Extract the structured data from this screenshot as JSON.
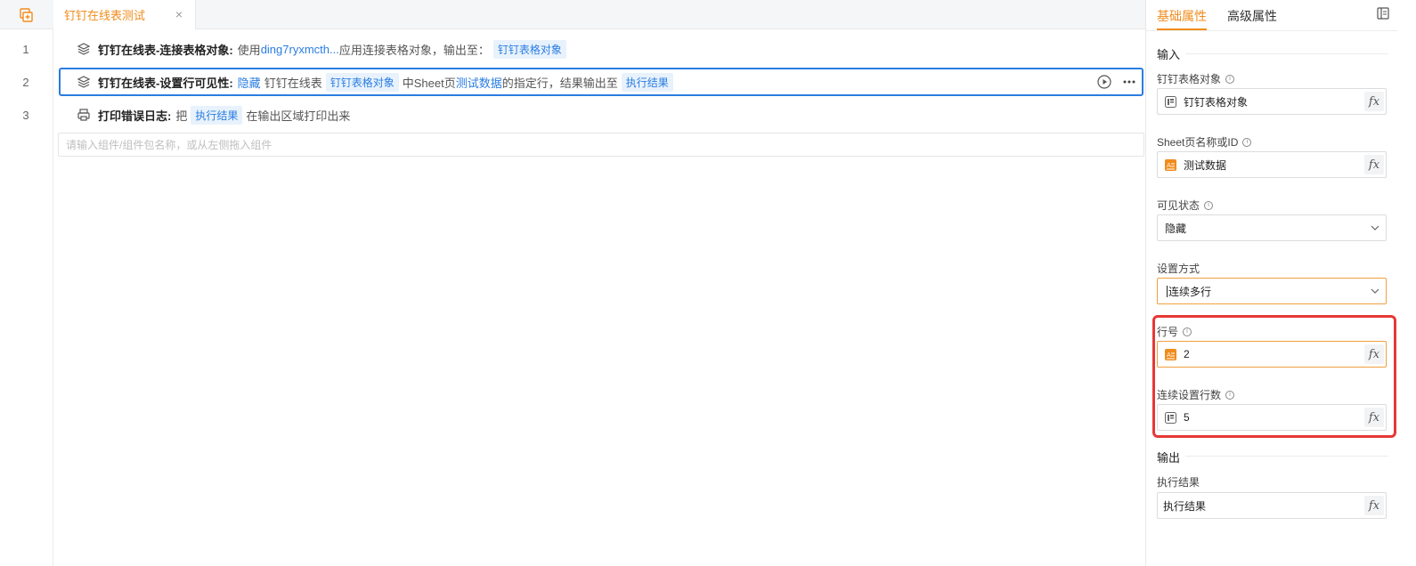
{
  "topbar": {
    "tab_label": "钉钉在线表测试",
    "close_glyph": "×"
  },
  "lines": [
    "1",
    "2",
    "3"
  ],
  "steps": [
    {
      "title": "钉钉在线表-连接表格对象:",
      "pre": "使用",
      "link": "ding7ryxmcth...",
      "mid": "应用连接表格对象，输出至：",
      "chip": "钉钉表格对象"
    },
    {
      "title": "钉钉在线表-设置行可见性:",
      "link1": "隐藏",
      "txt1": "钉钉在线表",
      "chip1": "钉钉表格对象",
      "txt2": "中Sheet页",
      "link2": "测试数据",
      "txt3": "的指定行，结果输出至",
      "chip2": "执行结果"
    },
    {
      "title": "打印错误日志:",
      "pre": "把",
      "chip": "执行结果",
      "post": "在输出区域打印出来"
    }
  ],
  "search": {
    "placeholder": "请输入组件/组件包名称，或从左侧拖入组件"
  },
  "panel": {
    "tab_basic": "基础属性",
    "tab_advanced": "高级属性",
    "section_input": "输入",
    "section_output": "输出",
    "fields": {
      "table_object": {
        "label": "钉钉表格对象",
        "value": "钉钉表格对象",
        "fx": "fx"
      },
      "sheet_name": {
        "label": "Sheet页名称或ID",
        "value": "测试数据",
        "fx": "fx"
      },
      "visible_state": {
        "label": "可见状态",
        "value": "隐藏"
      },
      "set_mode": {
        "label": "设置方式",
        "value": "连续多行"
      },
      "row_no": {
        "label": "行号",
        "value": "2",
        "fx": "fx"
      },
      "row_count": {
        "label": "连续设置行数",
        "value": "5",
        "fx": "fx"
      },
      "exec_result": {
        "label": "执行结果",
        "value": "执行结果",
        "fx": "fx"
      }
    }
  },
  "colors": {
    "accent": "#f08c1c",
    "link": "#2a7de1",
    "highlight": "#e53935"
  }
}
